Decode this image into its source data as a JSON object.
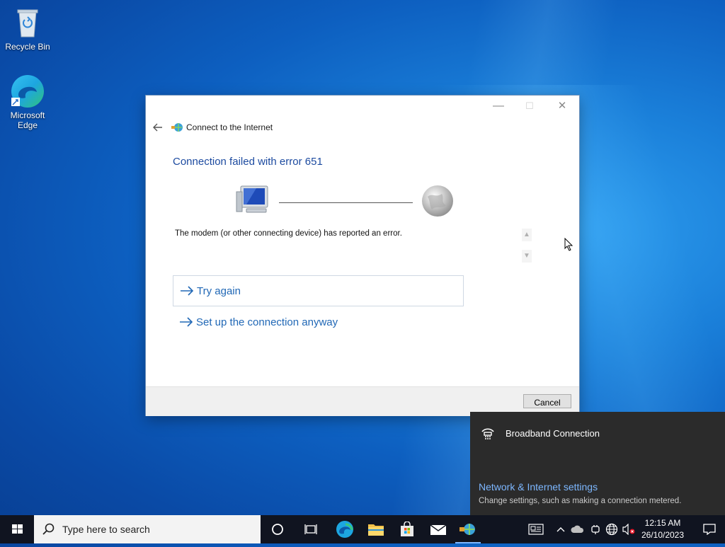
{
  "desktop": {
    "icons": [
      {
        "label": "Recycle Bin"
      },
      {
        "label": "Microsoft Edge"
      }
    ]
  },
  "dialog": {
    "window_controls": {
      "minimize": "—",
      "maximize": "☐",
      "close": "✕"
    },
    "app_title": "Connect to the Internet",
    "heading": "Connection failed with error 651",
    "message": "The modem (or other connecting device) has reported an error.",
    "options": [
      {
        "label": "Try again"
      },
      {
        "label": "Set up the connection anyway"
      }
    ],
    "cancel_label": "Cancel"
  },
  "network_flyout": {
    "connection_name": "Broadband Connection",
    "settings_link": "Network & Internet settings",
    "settings_desc": "Change settings, such as making a connection metered."
  },
  "taskbar": {
    "search_placeholder": "Type here to search",
    "clock_time": "12:15 AM",
    "clock_date": "26/10/2023",
    "accent": "#7db7ff"
  }
}
